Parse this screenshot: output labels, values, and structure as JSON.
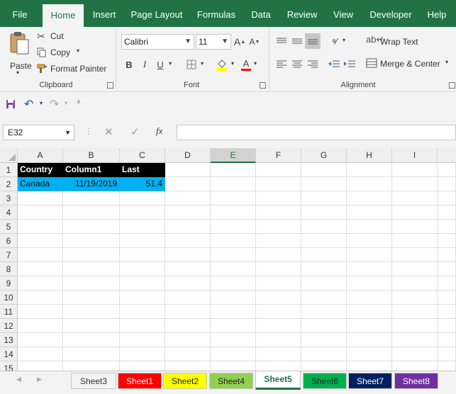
{
  "menu": {
    "tabs": [
      "File",
      "Home",
      "Insert",
      "Page Layout",
      "Formulas",
      "Data",
      "Review",
      "View",
      "Developer",
      "Help"
    ],
    "active": "Home"
  },
  "ribbon": {
    "clipboard": {
      "paste_label": "Paste",
      "cut_label": "Cut",
      "copy_label": "Copy",
      "format_painter_label": "Format Painter",
      "group_label": "Clipboard"
    },
    "font": {
      "font_name": "Calibri",
      "font_size": "11",
      "bold": "B",
      "italic": "I",
      "underline": "U",
      "grow": "A",
      "shrink": "A",
      "font_color": "A",
      "group_label": "Font"
    },
    "alignment": {
      "wrap_text_label": "Wrap Text",
      "merge_center_label": "Merge & Center",
      "group_label": "Alignment"
    }
  },
  "formula_bar": {
    "name_box": "E32",
    "fx_label": "fx",
    "formula": ""
  },
  "grid": {
    "columns": [
      "A",
      "B",
      "C",
      "D",
      "E",
      "F",
      "G",
      "H",
      "I"
    ],
    "selected_column": "E",
    "rows": [
      "1",
      "2",
      "3",
      "4",
      "5",
      "6",
      "7",
      "8",
      "9",
      "10",
      "11",
      "12",
      "13",
      "14",
      "15"
    ],
    "header_row": [
      "Country",
      "Column1",
      "Last"
    ],
    "data_row": [
      "Canada",
      "11/19/2019",
      "51.4"
    ]
  },
  "sheets": [
    {
      "name": "Sheet3",
      "color": "#f3f3f3",
      "text_color": "#333333"
    },
    {
      "name": "Sheet1",
      "color": "#ff0000",
      "text_color": "#ffffff"
    },
    {
      "name": "Sheet2",
      "color": "#ffff00",
      "text_color": "#222222"
    },
    {
      "name": "Sheet4",
      "color": "#92d050",
      "text_color": "#222222"
    },
    {
      "name": "Sheet5",
      "color": "#ffffff",
      "text_color": "#217346",
      "active": true
    },
    {
      "name": "Sheet6",
      "color": "#00b050",
      "text_color": "#222222"
    },
    {
      "name": "Sheet7",
      "color": "#002060",
      "text_color": "#ffffff"
    },
    {
      "name": "Sheet8",
      "color": "#7030a0",
      "text_color": "#ffffff"
    }
  ],
  "colors": {
    "accent": "#217346",
    "header_fill": "#000000",
    "data_fill": "#00b0f0"
  }
}
